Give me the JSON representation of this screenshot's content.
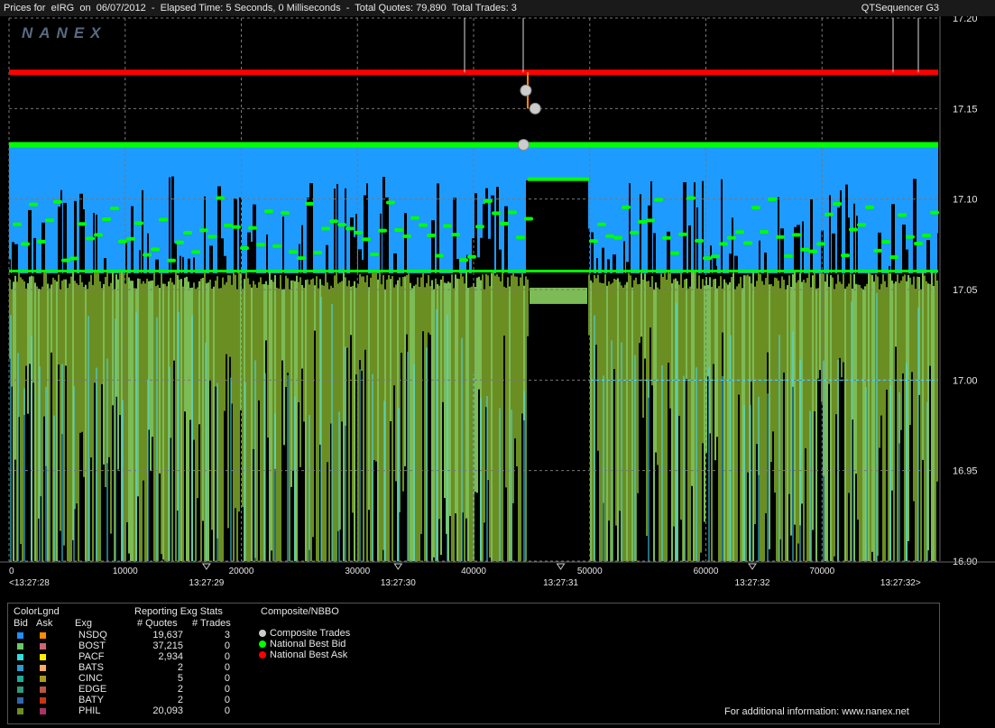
{
  "titlebar": {
    "title": "Prices for  eIRG  on  06/07/2012  -  Elapsed Time: 5 Seconds, 0 Milliseconds  -  Total Quotes: 79,890  Total Trades: 3",
    "app": "QTSequencer G3"
  },
  "watermark": "NANEX",
  "chart_data": {
    "type": "line",
    "ylim": [
      16.9,
      17.2
    ],
    "xlim": [
      0,
      80000
    ],
    "y_ticks": [
      "17.20",
      "17.15",
      "17.10",
      "17.05",
      "17.00",
      "16.95",
      "16.90"
    ],
    "x_ticks": [
      {
        "label": "0",
        "x": 0
      },
      {
        "label": "10000",
        "x": 10000
      },
      {
        "label": "20000",
        "x": 20000
      },
      {
        "label": "30000",
        "x": 30000
      },
      {
        "label": "40000",
        "x": 40000
      },
      {
        "label": "50000",
        "x": 50000
      },
      {
        "label": "60000",
        "x": 60000
      },
      {
        "label": "70000",
        "x": 70000
      }
    ],
    "time_labels": [
      {
        "label": "<13:27:28",
        "x": 0
      },
      {
        "label": "13:27:29",
        "x": 17000
      },
      {
        "label": "13:27:30",
        "x": 33500
      },
      {
        "label": "13:27:31",
        "x": 47500
      },
      {
        "label": "13:27:32",
        "x": 64000
      },
      {
        "label": "13:27:32>",
        "x": 78500
      }
    ],
    "national_best_ask": 17.17,
    "national_best_bid": 17.13,
    "composite_trades": [
      {
        "x": 44500,
        "price": 17.16
      },
      {
        "x": 45300,
        "price": 17.15
      },
      {
        "x": 44300,
        "price": 17.13
      }
    ]
  },
  "legend": {
    "colorlgnd_label": "ColorLgnd",
    "bid_label": "Bid",
    "ask_label": "Ask",
    "exg_header": "Exg",
    "stats_title": "Reporting Exg Stats",
    "quotes_header": "# Quotes",
    "trades_header": "# Trades",
    "rows": [
      {
        "exg": "NSDQ",
        "quotes": "19,637",
        "trades": "3",
        "bid_color": "#1e90ff",
        "ask_color": "#ff8c00"
      },
      {
        "exg": "BOST",
        "quotes": "37,215",
        "trades": "0",
        "bid_color": "#66cc66",
        "ask_color": "#cc6677"
      },
      {
        "exg": "PACF",
        "quotes": "2,934",
        "trades": "0",
        "bid_color": "#33dddd",
        "ask_color": "#ffee00"
      },
      {
        "exg": "BATS",
        "quotes": "2",
        "trades": "0",
        "bid_color": "#3399cc",
        "ask_color": "#ffaa66"
      },
      {
        "exg": "CINC",
        "quotes": "5",
        "trades": "0",
        "bid_color": "#22aa99",
        "ask_color": "#aa9922"
      },
      {
        "exg": "EDGE",
        "quotes": "2",
        "trades": "0",
        "bid_color": "#339977",
        "ask_color": "#bb5544"
      },
      {
        "exg": "BATY",
        "quotes": "2",
        "trades": "0",
        "bid_color": "#3366aa",
        "ask_color": "#cc3311"
      },
      {
        "exg": "PHIL",
        "quotes": "20,093",
        "trades": "0",
        "bid_color": "#6b8e23",
        "ask_color": "#aa3366"
      }
    ],
    "nbbo_title": "Composite/NBBO",
    "nbbo_items": [
      {
        "label": "Composite Trades",
        "color": "#cccccc"
      },
      {
        "label": "National Best Bid",
        "color": "#00ff00"
      },
      {
        "label": "National Best Ask",
        "color": "#ff0000"
      }
    ],
    "footer": "For additional information:  www.nanex.net"
  },
  "colors": {
    "ask_fill": "#1e9bff",
    "bid_fill": "#6b8e23",
    "bid_fill_light": "#7cbb55",
    "bid_edge": "#00ff00",
    "ask_line": "#ff0000",
    "cyan": "#40e0ff"
  }
}
